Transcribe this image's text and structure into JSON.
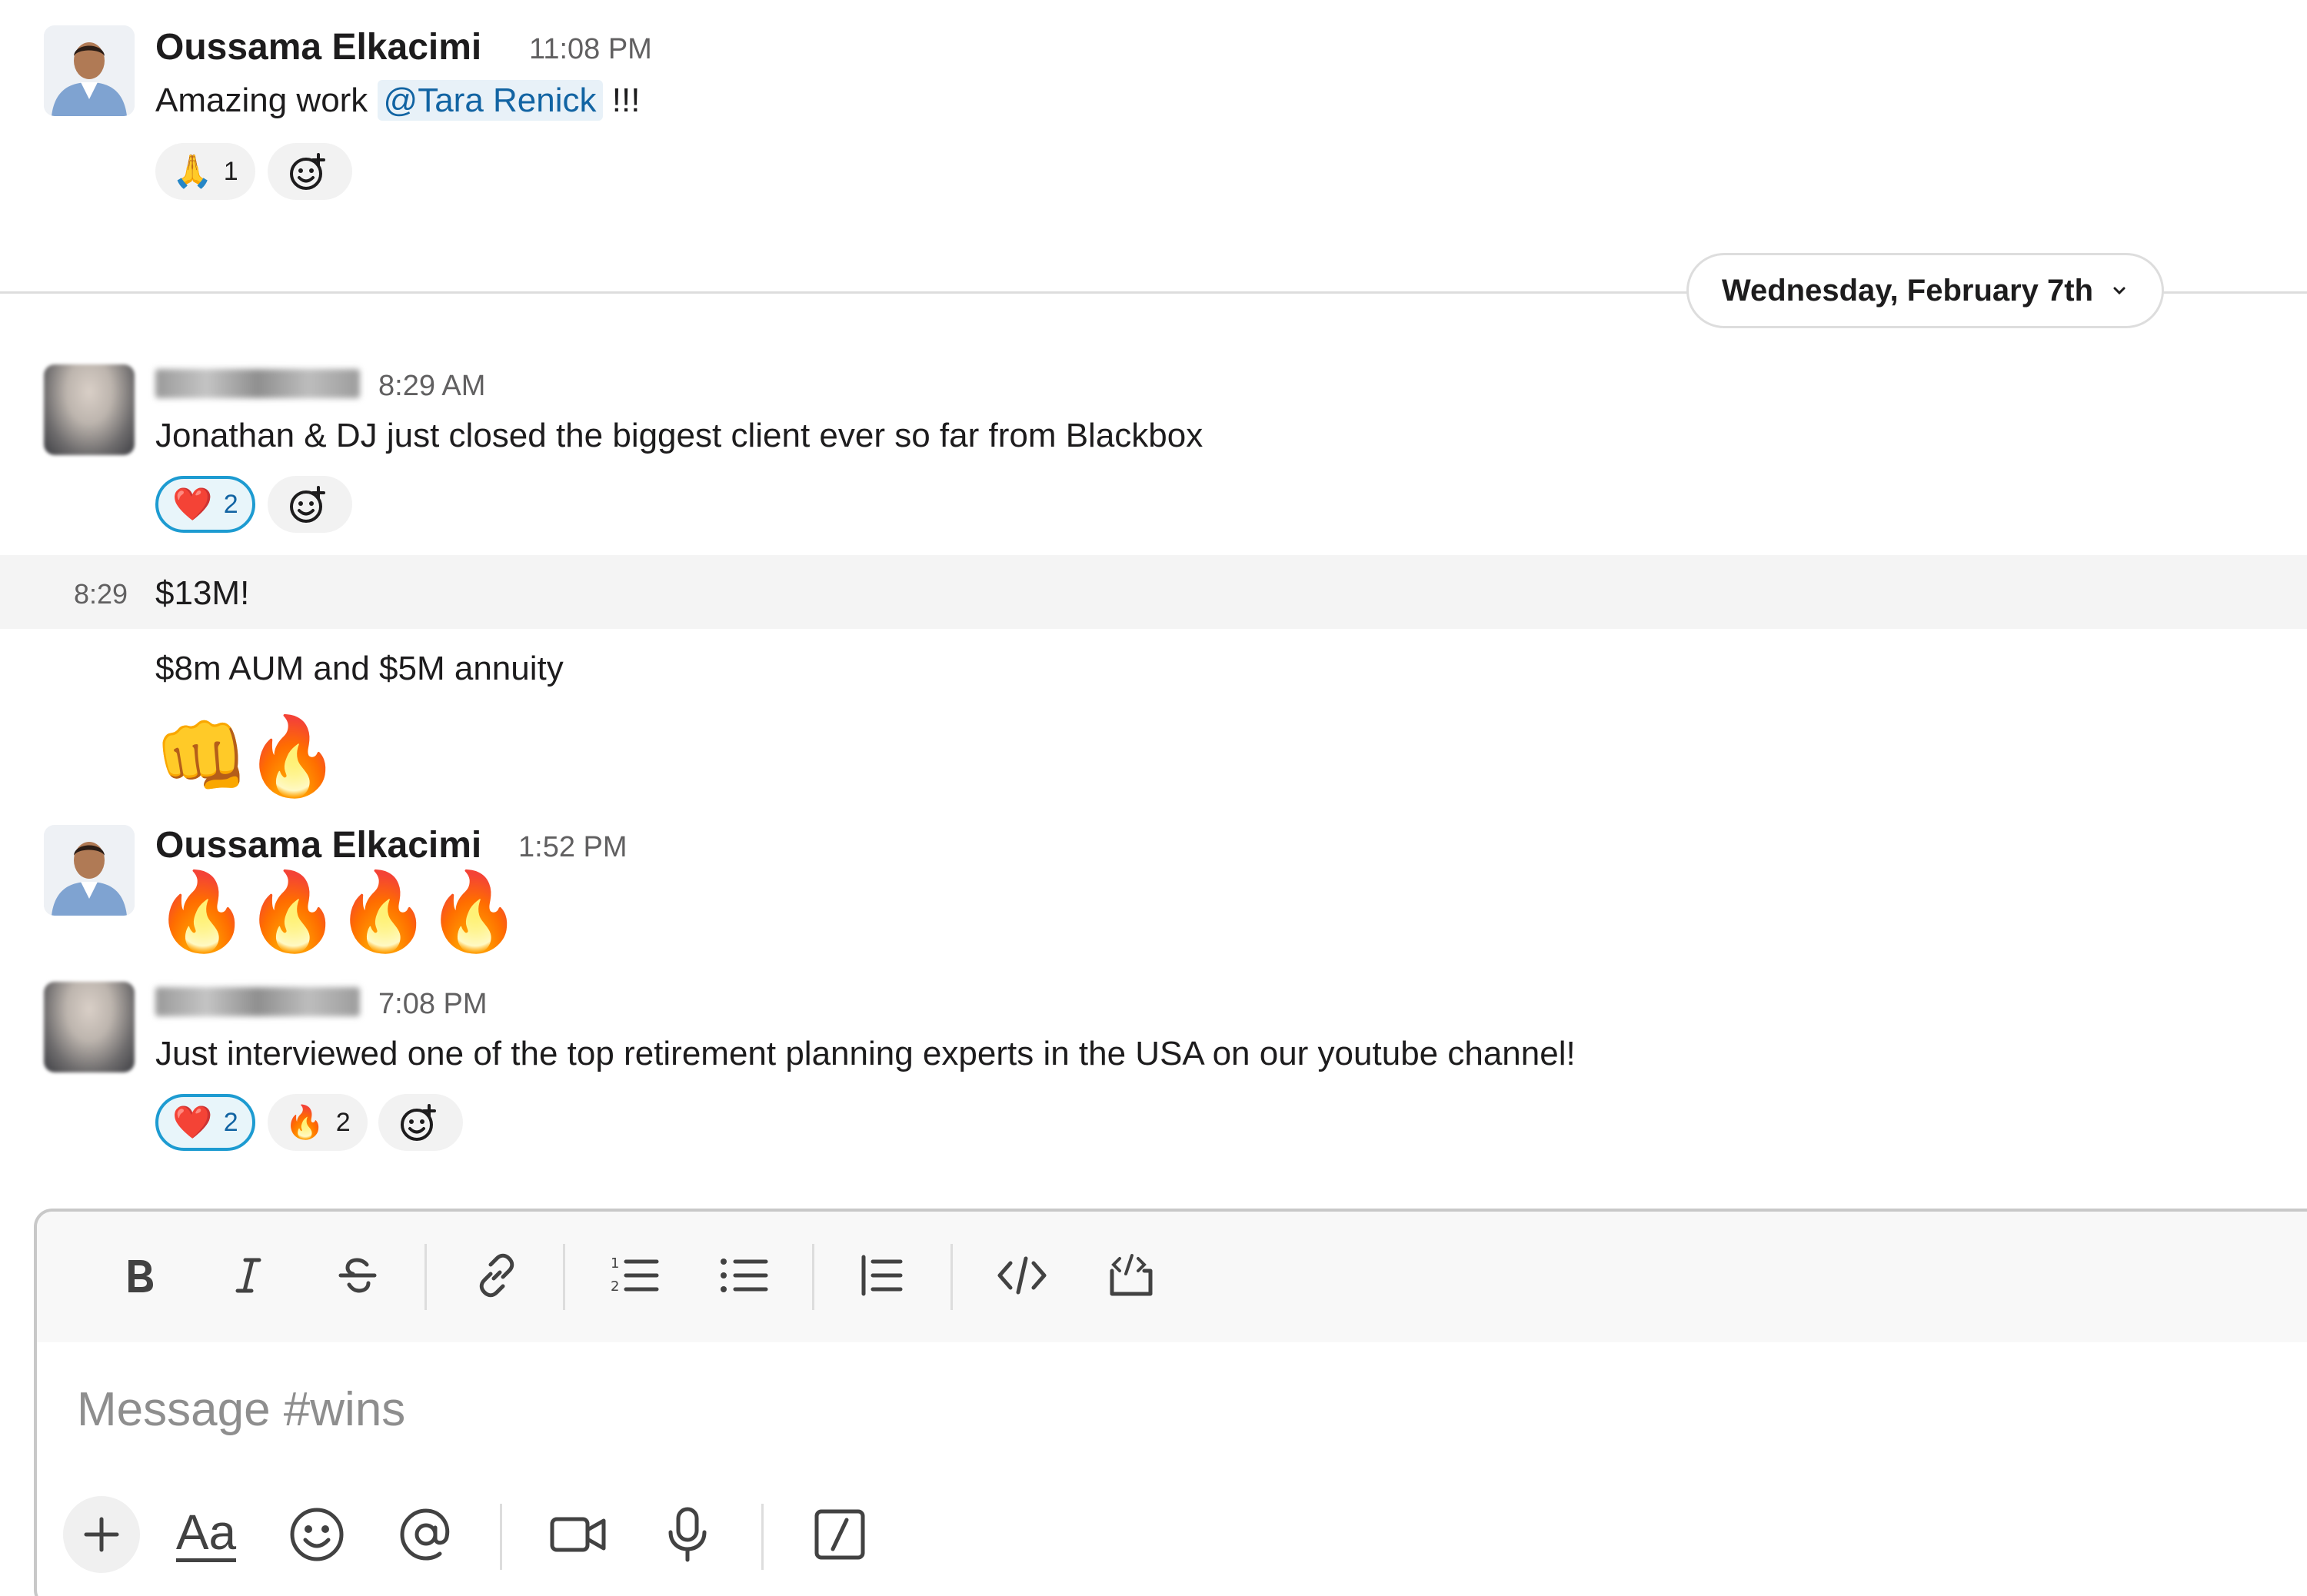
{
  "messages": [
    {
      "author": "Oussama Elkacimi",
      "time": "11:08 PM",
      "text_before": "Amazing work ",
      "mention": "@Tara Renick",
      "text_after": " !!!",
      "reactions": [
        {
          "emoji": "🙏",
          "count": "1"
        }
      ]
    },
    {
      "author": "",
      "time": "8:29 AM",
      "text": "Jonathan & DJ just closed the biggest client ever so far from Blackbox",
      "reactions": [
        {
          "emoji": "❤️",
          "count": "2"
        }
      ]
    },
    {
      "hover_time": "8:29",
      "text": "$13M!"
    },
    {
      "text": "$8m AUM and $5M annuity",
      "emoji_line": [
        "👊",
        "🔥"
      ]
    },
    {
      "author": "Oussama Elkacimi",
      "time": "1:52 PM",
      "emoji_line": [
        "🔥",
        "🔥",
        "🔥",
        "🔥"
      ]
    },
    {
      "author": "",
      "time": "7:08 PM",
      "text": "Just interviewed one of the top retirement planning experts in the USA on our youtube channel!",
      "reactions": [
        {
          "emoji": "❤️",
          "count": "2"
        },
        {
          "emoji": "🔥",
          "count": "2"
        }
      ]
    }
  ],
  "date_divider": "Wednesday, February 7th",
  "composer": {
    "placeholder": "Message #wins",
    "toolbar_icons": [
      "bold-icon",
      "italic-icon",
      "strikethrough-icon",
      "link-icon",
      "ordered-list-icon",
      "bulleted-list-icon",
      "blockquote-icon",
      "code-icon",
      "code-block-icon"
    ],
    "bottom_icons": [
      "plus-icon",
      "formatting-icon",
      "emoji-icon",
      "mention-icon",
      "video-icon",
      "microphone-icon",
      "slash-command-icon"
    ],
    "formatting_label": "Aa"
  },
  "colors": {
    "mention_text": "#1264a3",
    "mention_bg": "#e8f1f8",
    "active_reaction_border": "#1d9bd1"
  }
}
